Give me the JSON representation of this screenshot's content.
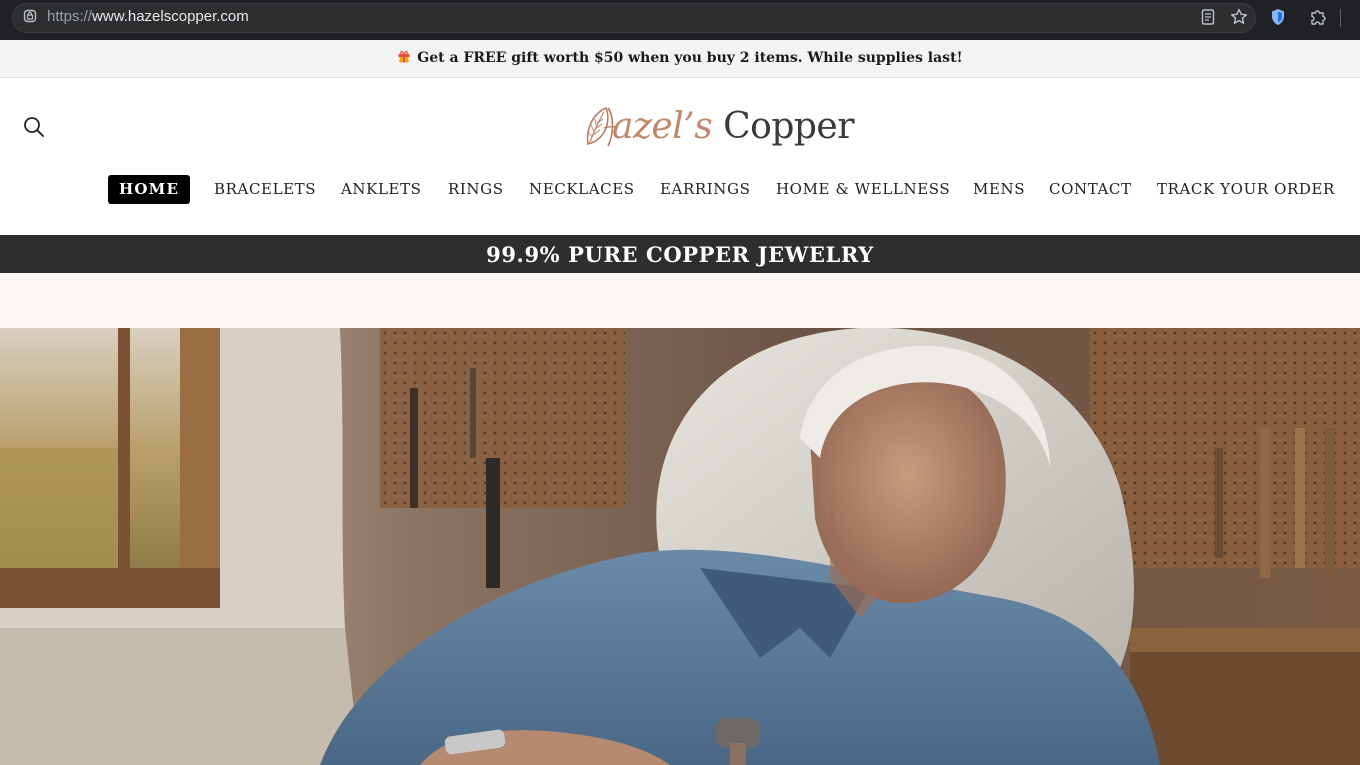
{
  "browser": {
    "url_protocol": "https://",
    "url_host": "www.hazelscopper.com",
    "icons": [
      "lock-icon",
      "reader-mode-icon",
      "bookmark-star-icon",
      "shield-extension-icon",
      "extensions-puzzle-icon"
    ]
  },
  "announcement": {
    "icon": "gift-icon",
    "text": "Get a FREE gift worth $50 when you buy 2 items. While supplies last!"
  },
  "header": {
    "search_icon": "search-icon",
    "logo": {
      "first": "Hazel's",
      "first_display": "azel’s",
      "second": "Copper"
    }
  },
  "nav": {
    "items": [
      {
        "label": "HOME",
        "active": true
      },
      {
        "label": "BRACELETS",
        "active": false
      },
      {
        "label": "ANKLETS",
        "active": false
      },
      {
        "label": "RINGS",
        "active": false
      },
      {
        "label": "NECKLACES",
        "active": false
      },
      {
        "label": "EARRINGS",
        "active": false
      },
      {
        "label": "HOME & WELLNESS",
        "active": false
      },
      {
        "label": "MENS",
        "active": false
      },
      {
        "label": "CONTACT",
        "active": false
      },
      {
        "label": "TRACK YOUR ORDER",
        "active": false
      }
    ]
  },
  "banner": {
    "text": "99.9% PURE COPPER JEWELRY"
  },
  "colors": {
    "brand_copper": "#c0876a",
    "banner_bg": "#2e2e2c",
    "announce_bg": "#f3f3f3",
    "nav_active_bg": "#000000"
  }
}
